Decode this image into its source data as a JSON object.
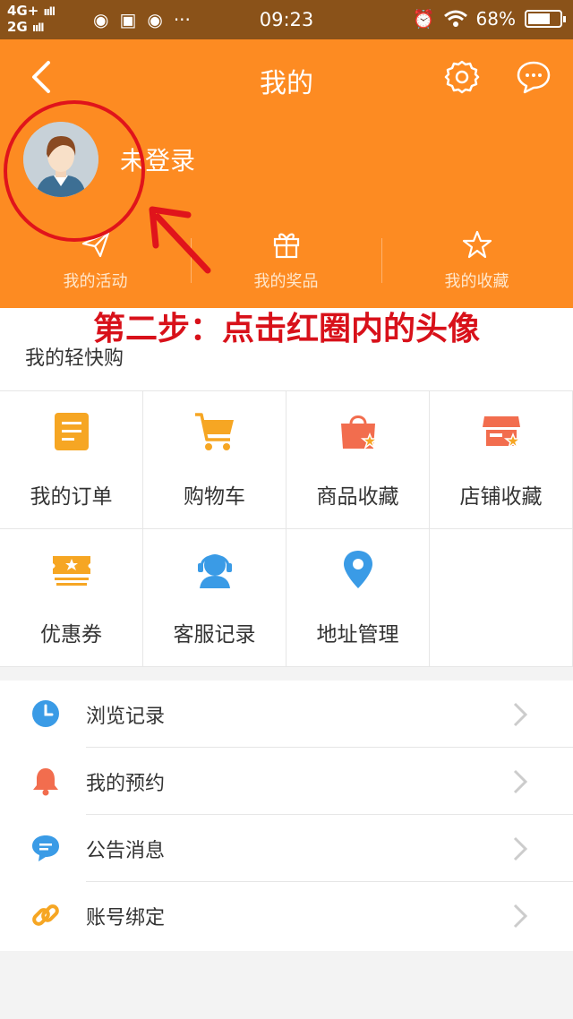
{
  "status_bar": {
    "network_top": "4G+",
    "network_bottom": "2G",
    "time": "09:23",
    "battery": "68%"
  },
  "header": {
    "title": "我的",
    "login_text": "未登录",
    "quick_links": [
      {
        "label": "我的活动",
        "icon": "paper-plane-icon"
      },
      {
        "label": "我的奖品",
        "icon": "gift-icon"
      },
      {
        "label": "我的收藏",
        "icon": "star-icon"
      }
    ]
  },
  "instruction": "第二步：点击红圈内的头像",
  "section": {
    "title": "我的轻快购",
    "grid": [
      {
        "label": "我的订单",
        "icon": "order-icon"
      },
      {
        "label": "购物车",
        "icon": "cart-icon"
      },
      {
        "label": "商品收藏",
        "icon": "product-favorite-icon"
      },
      {
        "label": "店铺收藏",
        "icon": "store-favorite-icon"
      },
      {
        "label": "优惠券",
        "icon": "coupon-icon"
      },
      {
        "label": "客服记录",
        "icon": "customer-service-icon"
      },
      {
        "label": "地址管理",
        "icon": "location-icon"
      }
    ]
  },
  "list": [
    {
      "label": "浏览记录",
      "icon": "clock-icon"
    },
    {
      "label": "我的预约",
      "icon": "bell-icon"
    },
    {
      "label": "公告消息",
      "icon": "message-icon"
    },
    {
      "label": "账号绑定",
      "icon": "link-icon"
    }
  ],
  "colors": {
    "header": "#fd8b22",
    "accent_red": "#d8111a",
    "status_bar": "#8a5219"
  }
}
